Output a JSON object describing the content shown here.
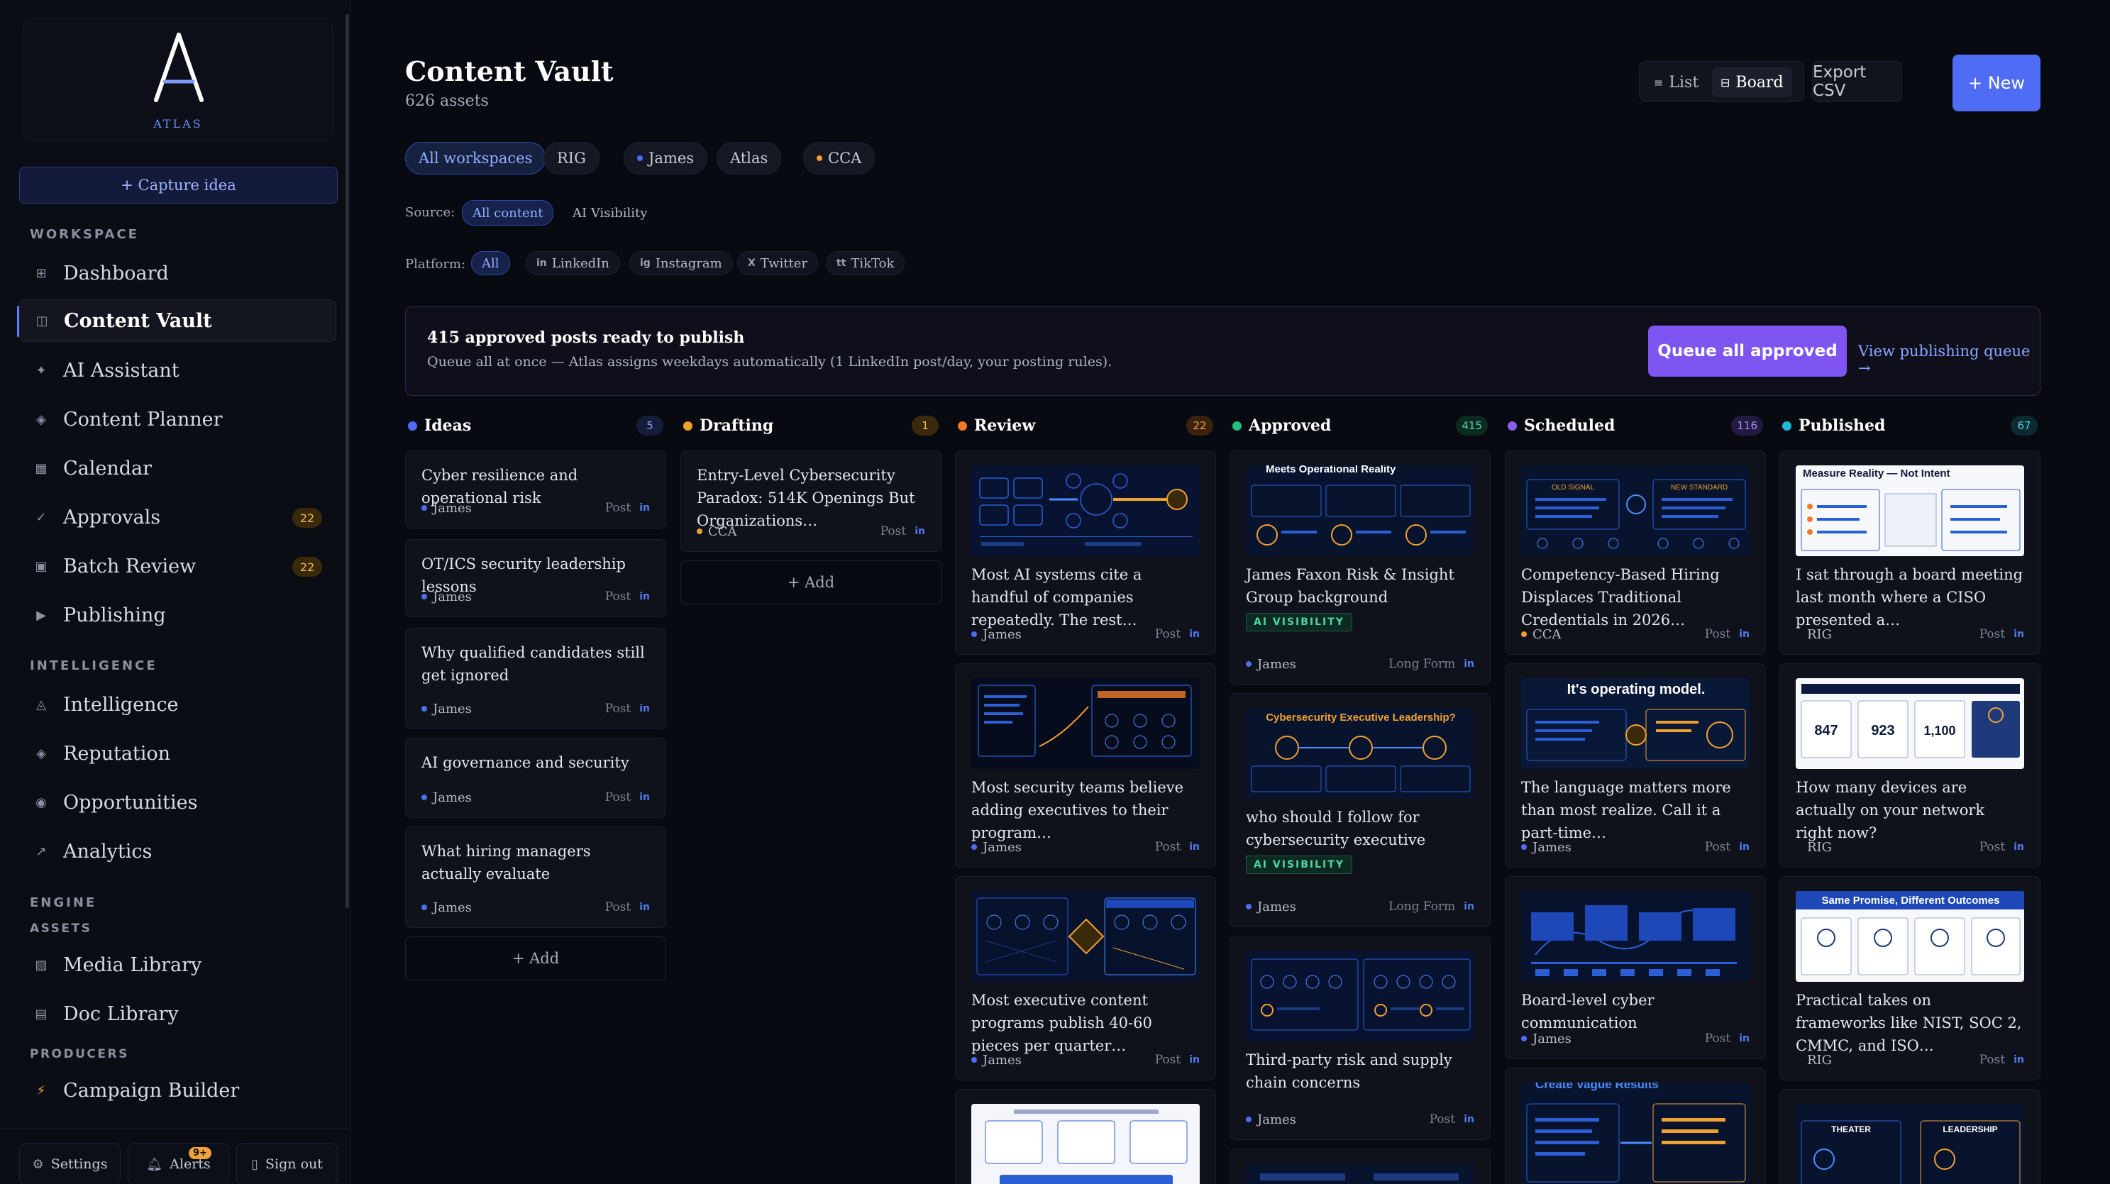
{
  "brand": {
    "name": "ATLAS"
  },
  "sidebar": {
    "capture_label": "+ Capture idea",
    "sections": {
      "workspace": "WORKSPACE",
      "intelligence": "INTELLIGENCE",
      "engine": "ENGINE",
      "assets": "ASSETS",
      "producers": "PRODUCERS"
    },
    "items": [
      {
        "label": "Dashboard",
        "icon": "grid-icon"
      },
      {
        "label": "Content Vault",
        "icon": "vault-icon"
      },
      {
        "label": "AI Assistant",
        "icon": "sparkle-icon"
      },
      {
        "label": "Content Planner",
        "icon": "planner-icon"
      },
      {
        "label": "Calendar",
        "icon": "calendar-icon"
      },
      {
        "label": "Approvals",
        "icon": "check-icon",
        "badge": "22"
      },
      {
        "label": "Batch Review",
        "icon": "batch-icon",
        "badge": "22"
      },
      {
        "label": "Publishing",
        "icon": "play-icon"
      },
      {
        "label": "Intelligence",
        "icon": "triangle-icon"
      },
      {
        "label": "Reputation",
        "icon": "diamond-icon"
      },
      {
        "label": "Opportunities",
        "icon": "target-icon"
      },
      {
        "label": "Analytics",
        "icon": "trend-icon"
      },
      {
        "label": "Media Library",
        "icon": "media-icon"
      },
      {
        "label": "Doc Library",
        "icon": "doc-icon"
      },
      {
        "label": "Campaign Builder",
        "icon": "bolt-icon"
      }
    ],
    "bottom": {
      "settings": "Settings",
      "alerts": "Alerts",
      "alerts_badge": "9+",
      "signout": "Sign out"
    }
  },
  "header": {
    "title": "Content Vault",
    "subtitle": "626 assets",
    "view_list": "List",
    "view_board": "Board",
    "export": "Export CSV",
    "new": "+ New"
  },
  "filters": {
    "workspaces": [
      "All workspaces",
      "RIG",
      "James",
      "Atlas",
      "CCA"
    ],
    "source_label": "Source:",
    "sources": [
      "All content",
      "AI Visibility"
    ],
    "platform_label": "Platform:",
    "platforms": [
      "All",
      "LinkedIn",
      "Instagram",
      "Twitter",
      "TikTok"
    ],
    "platform_icons": [
      "",
      "in",
      "ig",
      "X",
      "tt"
    ]
  },
  "banner": {
    "title": "415 approved posts ready to publish",
    "text": "Queue all at once — Atlas assigns weekdays automatically (1 LinkedIn post/day, your posting rules).",
    "button": "Queue all approved",
    "link": "View publishing queue →"
  },
  "board": {
    "add_label": "+ Add",
    "ai_tag": "AI VISIBILITY",
    "columns": [
      {
        "name": "Ideas",
        "count": "5",
        "color": "#4f6cf5"
      },
      {
        "name": "Drafting",
        "count": "1",
        "color": "#f0a030"
      },
      {
        "name": "Review",
        "count": "22",
        "color": "#f07a28"
      },
      {
        "name": "Approved",
        "count": "415",
        "color": "#22c07a"
      },
      {
        "name": "Scheduled",
        "count": "116",
        "color": "#8a5cf0"
      },
      {
        "name": "Published",
        "count": "67",
        "color": "#22b8d8"
      }
    ],
    "ideas": [
      {
        "title": "Cyber resilience and operational risk",
        "owner": "James",
        "type": "Post"
      },
      {
        "title": "OT/ICS security leadership lessons",
        "owner": "James",
        "type": "Post"
      },
      {
        "title": "Why qualified candidates still get ignored",
        "owner": "James",
        "type": "Post"
      },
      {
        "title": "AI governance and security",
        "owner": "James",
        "type": "Post"
      },
      {
        "title": "What hiring managers actually evaluate",
        "owner": "James",
        "type": "Post"
      }
    ],
    "drafting": [
      {
        "title": "Entry-Level Cybersecurity Paradox: 514K Openings But Organizations…",
        "owner": "CCA",
        "type": "Post"
      }
    ],
    "review": [
      {
        "title": "Most AI systems cite a handful of companies repeatedly. The rest…",
        "owner": "James",
        "type": "Post"
      },
      {
        "title": "Most security teams believe adding executives to their program…",
        "owner": "James",
        "type": "Post"
      },
      {
        "title": "Most executive content programs publish 40-60 pieces per quarter…",
        "owner": "James",
        "type": "Post"
      }
    ],
    "approved": [
      {
        "title": "James Faxon Risk & Insight Group background",
        "owner": "James",
        "type": "Long Form"
      },
      {
        "title": "who should I follow for cybersecurity executive leadership",
        "owner": "James",
        "type": "Long Form"
      },
      {
        "title": "Third-party risk and supply chain concerns",
        "owner": "James",
        "type": "Post"
      }
    ],
    "scheduled": [
      {
        "title": "Competency-Based Hiring Displaces Traditional Credentials in 2026…",
        "owner": "CCA",
        "type": "Post"
      },
      {
        "title": "The language matters more than most realize. Call it a part-time…",
        "owner": "James",
        "type": "Post"
      },
      {
        "title": "Board-level cyber communication",
        "owner": "James",
        "type": "Post"
      }
    ],
    "published": [
      {
        "title": "I sat through a board meeting last month where a CISO presented a…",
        "owner": "RIG",
        "type": "Post"
      },
      {
        "title": "How many devices are actually on your network right now?",
        "owner": "RIG",
        "type": "Post"
      },
      {
        "title": "Practical takes on frameworks like NIST, SOC 2, CMMC, and ISO…",
        "owner": "RIG",
        "type": "Post"
      }
    ],
    "thumb_text": {
      "approved_1": "Meets Operational Reality",
      "approved_2": "Cybersecurity Executive Leadership?",
      "scheduled_1a": "OLD SIGNAL",
      "scheduled_1b": "NEW STANDARD",
      "scheduled_2": "It's operating model.",
      "scheduled_4": "Create Vague Results",
      "published_1": "Measure Reality — Not Intent",
      "published_2a": "847",
      "published_2b": "923",
      "published_2c": "1,100",
      "published_3": "Same Promise, Different Outcomes",
      "published_4a": "THEATER",
      "published_4b": "LEADERSHIP"
    },
    "owner_colors": {
      "James": "#4f6cf5",
      "CCA": "#f0a030",
      "RIG": "#8a8f9f"
    }
  }
}
